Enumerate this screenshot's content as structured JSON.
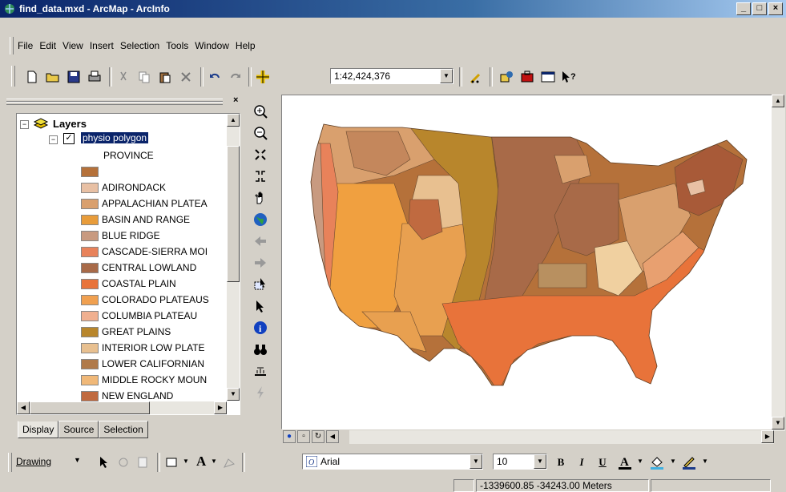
{
  "window": {
    "title": "find_data.mxd - ArcMap - ArcInfo",
    "min": "_",
    "max": "□",
    "close": "×"
  },
  "menu": [
    "File",
    "Edit",
    "View",
    "Insert",
    "Selection",
    "Tools",
    "Window",
    "Help"
  ],
  "toolbar": {
    "scale": "1:42,424,376"
  },
  "toc": {
    "root_label": "Layers",
    "layer_label": "physio polygon",
    "field_label": "PROVINCE",
    "items": [
      {
        "label": "",
        "color": "#b5713a"
      },
      {
        "label": "ADIRONDACK",
        "color": "#e8c0a4"
      },
      {
        "label": "APPALACHIAN PLATEA",
        "color": "#d9a06e"
      },
      {
        "label": "BASIN AND RANGE",
        "color": "#e89c3a"
      },
      {
        "label": "BLUE RIDGE",
        "color": "#c89a80"
      },
      {
        "label": "CASCADE-SIERRA MOI",
        "color": "#e8825a"
      },
      {
        "label": "CENTRAL LOWLAND",
        "color": "#a86a48"
      },
      {
        "label": "COASTAL PLAIN",
        "color": "#e8733a"
      },
      {
        "label": "COLORADO PLATEAUS",
        "color": "#f0a050"
      },
      {
        "label": "COLUMBIA PLATEAU",
        "color": "#f0b090"
      },
      {
        "label": "GREAT PLAINS",
        "color": "#b8862c"
      },
      {
        "label": "INTERIOR LOW PLATE",
        "color": "#e8c090"
      },
      {
        "label": "LOWER CALIFORNIAN",
        "color": "#b07a4a"
      },
      {
        "label": "MIDDLE ROCKY MOUN",
        "color": "#f0b878"
      },
      {
        "label": "NEW ENGLAND",
        "color": "#c06a40"
      }
    ],
    "tabs": [
      "Display",
      "Source",
      "Selection"
    ]
  },
  "drawing": {
    "label": "Drawing",
    "font": "Arial",
    "size": "10",
    "bold": "B",
    "italic": "I",
    "underline": "U",
    "text_tool": "A"
  },
  "status": {
    "coords": "-1339600.85  -34243.00 Meters"
  }
}
